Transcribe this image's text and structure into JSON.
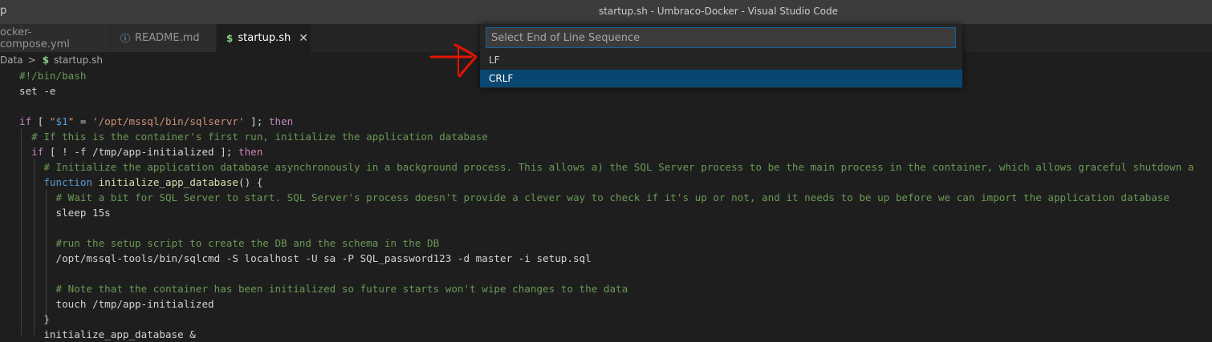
{
  "titlebar": {
    "menu_fragment": "p",
    "window_title": "startup.sh - Umbraco-Docker - Visual Studio Code"
  },
  "tabs": [
    {
      "label": "ocker-compose.yml",
      "icon": "yml-file-icon",
      "active": false
    },
    {
      "label": "README.md",
      "icon": "info-icon",
      "active": false
    },
    {
      "label": "startup.sh",
      "icon": "dollar-icon",
      "active": true,
      "close": "✕"
    }
  ],
  "breadcrumb": {
    "folder": "Data",
    "separator": ">",
    "file_icon": "$",
    "file": "startup.sh"
  },
  "code_lines": [
    "#!/bin/bash",
    "set -e",
    "",
    "if [ \"$1\" = '/opt/mssql/bin/sqlservr' ]; then",
    "  # If this is the container's first run, initialize the application database",
    "  if [ ! -f /tmp/app-initialized ]; then",
    "    # Initialize the application database asynchronously in a background process. This allows a) the SQL Server process to be the main process in the container, which allows graceful shutdown a",
    "    function initialize_app_database() {",
    "      # Wait a bit for SQL Server to start. SQL Server's process doesn't provide a clever way to check if it's up or not, and it needs to be up before we can import the application database",
    "      sleep 15s",
    "",
    "      #run the setup script to create the DB and the schema in the DB",
    "      /opt/mssql-tools/bin/sqlcmd -S localhost -U sa -P SQL_password123 -d master -i setup.sql",
    "",
    "      # Note that the container has been initialized so future starts won't wipe changes to the data",
    "      touch /tmp/app-initialized",
    "    }",
    "    initialize_app_database &"
  ],
  "quick_pick": {
    "placeholder": "Select End of Line Sequence",
    "value": "",
    "items": [
      {
        "label": "LF",
        "selected": false
      },
      {
        "label": "CRLF",
        "selected": true
      }
    ]
  },
  "colors": {
    "accent": "#0e639c",
    "selection": "#094771",
    "annotation": "#e51400"
  }
}
